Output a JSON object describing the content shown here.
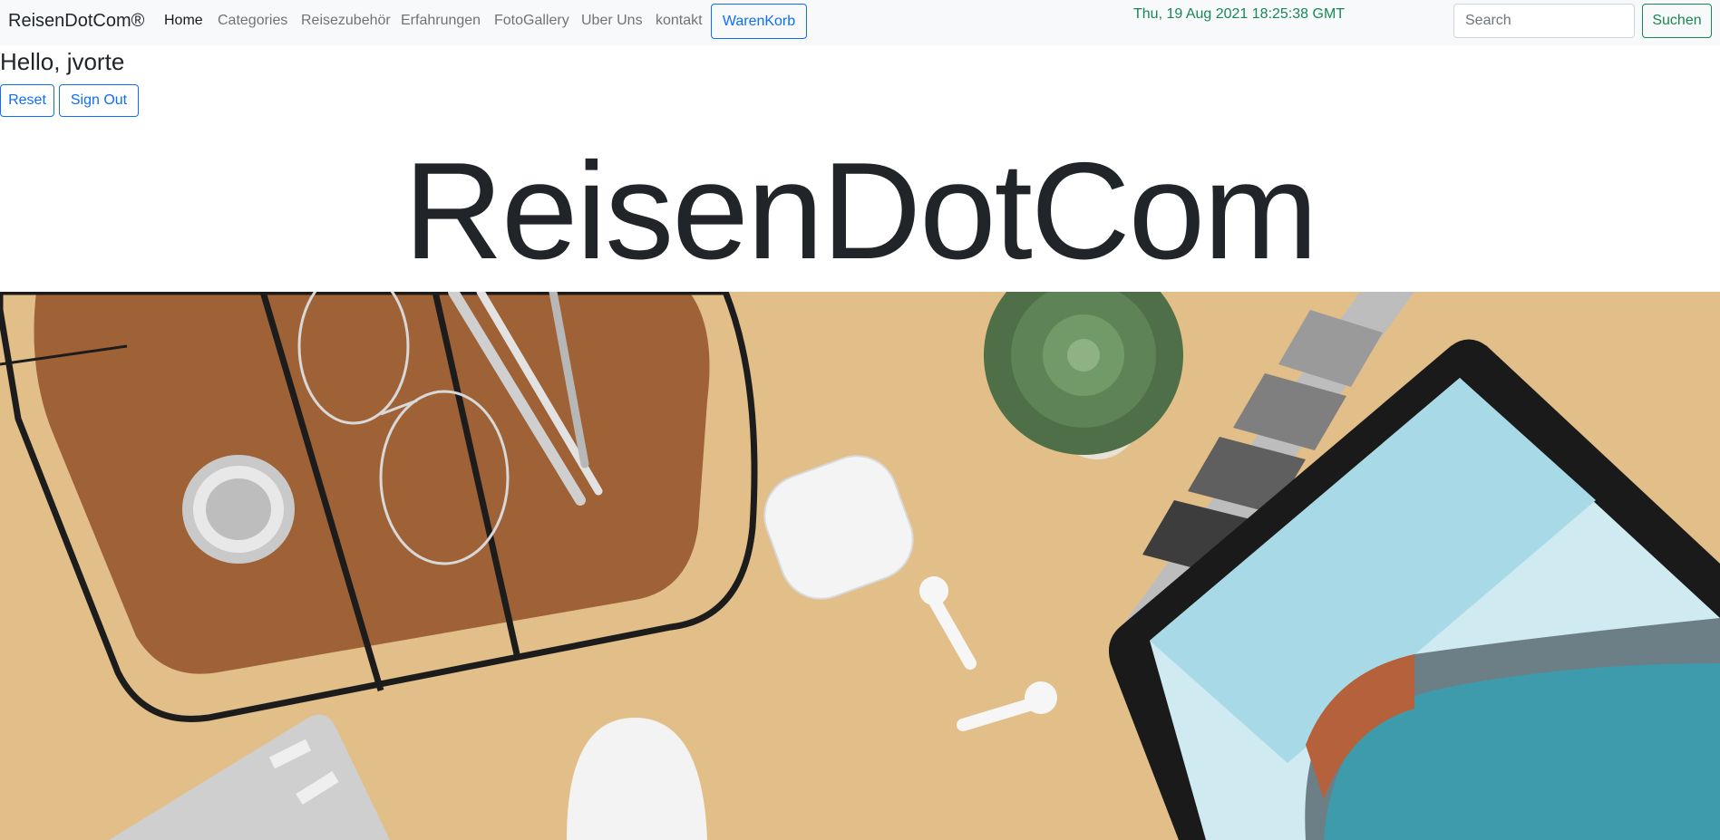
{
  "navbar": {
    "brand": "ReisenDotCom®",
    "links": [
      {
        "label": "Home",
        "active": true
      },
      {
        "label": "Categories"
      },
      {
        "label": "Reisezubehör"
      },
      {
        "label": "Erfahrungen"
      },
      {
        "label": "FotoGallery"
      },
      {
        "label": "Uber Uns"
      },
      {
        "label": "kontakt"
      }
    ],
    "cart_label": "WarenKorb",
    "datetime": "Thu, 19 Aug 2021 18:25:38 GMT",
    "search_placeholder": "Search",
    "search_button": "Suchen"
  },
  "user": {
    "greeting": "Hello, jvorte",
    "reset_label": "Reset",
    "signout_label": "Sign Out"
  },
  "hero": {
    "title": "ReisenDotCom"
  },
  "colors": {
    "primary": "#0d6efd",
    "success": "#198754",
    "navbar_bg": "#f8f9fa",
    "photo_bg": "#e5c08a"
  }
}
